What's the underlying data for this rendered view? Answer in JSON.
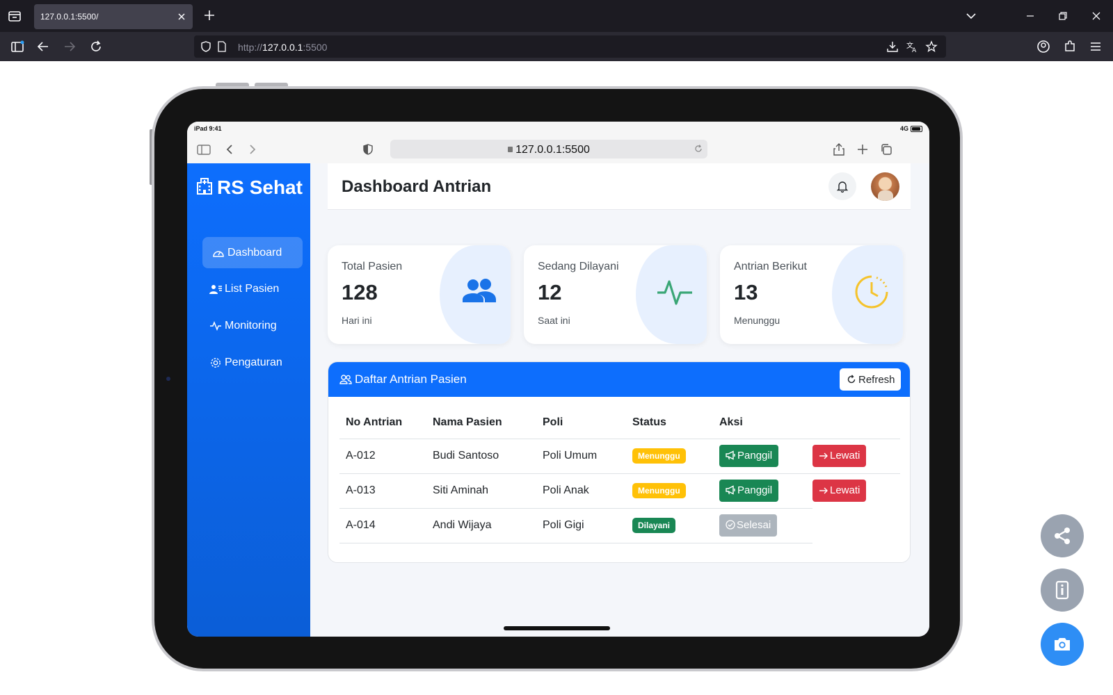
{
  "browser": {
    "tab_title": "127.0.0.1:5500/",
    "url_scheme": "http://",
    "url_host": "127.0.0.1",
    "url_port": ":5500"
  },
  "device": {
    "time": "iPad 9:41",
    "network": "4G",
    "safari_url": "127.0.0.1:5500"
  },
  "sidebar": {
    "brand": "RS Sehat",
    "items": [
      {
        "label": "Dashboard",
        "icon": "speedometer-icon",
        "active": true
      },
      {
        "label": "List Pasien",
        "icon": "person-lines-icon",
        "active": false
      },
      {
        "label": "Monitoring",
        "icon": "activity-icon",
        "active": false
      },
      {
        "label": "Pengaturan",
        "icon": "gear-icon",
        "active": false
      }
    ]
  },
  "header": {
    "title": "Dashboard Antrian"
  },
  "stats": [
    {
      "label": "Total Pasien",
      "value": "128",
      "sub": "Hari ini",
      "icon": "people-icon",
      "color": "#0d6efd"
    },
    {
      "label": "Sedang Dilayani",
      "value": "12",
      "sub": "Saat ini",
      "icon": "activity-icon",
      "color": "#198754"
    },
    {
      "label": "Antrian Berikut",
      "value": "13",
      "sub": "Menunggu",
      "icon": "clock-icon",
      "color": "#ffc107"
    }
  ],
  "queue": {
    "title": "Daftar Antrian Pasien",
    "refresh_label": "Refresh",
    "columns": [
      "No Antrian",
      "Nama Pasien",
      "Poli",
      "Status",
      "Aksi"
    ],
    "rows": [
      {
        "no": "A-012",
        "name": "Budi Santoso",
        "poli": "Poli Umum",
        "status": "Menunggu",
        "action": "Panggil",
        "skip": "Lewati"
      },
      {
        "no": "A-013",
        "name": "Siti Aminah",
        "poli": "Poli Anak",
        "status": "Menunggu",
        "action": "Panggil",
        "skip": "Lewati"
      },
      {
        "no": "A-014",
        "name": "Andi Wijaya",
        "poli": "Poli Gigi",
        "status": "Dilayani",
        "action": "Selesai",
        "skip": ""
      }
    ]
  },
  "colors": {
    "primary": "#0d6efd",
    "success": "#198754",
    "warning": "#ffc107",
    "danger": "#dc3545"
  }
}
